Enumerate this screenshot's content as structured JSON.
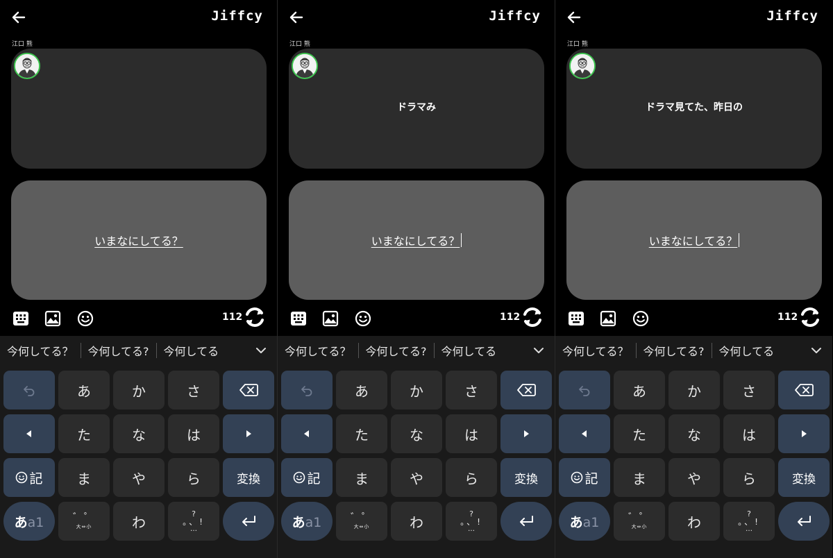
{
  "app": {
    "title": "Jiffcy"
  },
  "author": {
    "name": "江口 熊"
  },
  "input": {
    "placeholder": "いまなにしてる？"
  },
  "char_count": "112",
  "suggestions": [
    "今何してる？",
    "今何してる?",
    "今何してる"
  ],
  "keys": {
    "a": "あ",
    "ka": "か",
    "sa": "さ",
    "ta": "た",
    "na": "な",
    "ha": "は",
    "ma": "ま",
    "ya": "や",
    "ra": "ら",
    "wa": "わ",
    "kigou": "記",
    "henkan": "変換",
    "mode_kana": "あ",
    "mode_alnum": "a1",
    "dakuten_top": "゛゜",
    "dakuten_bottom": "大⇔小",
    "punct_top": "?",
    "punct_mid": "。、!",
    "punct_bottom": "…"
  },
  "panels": [
    {
      "post_text": "",
      "show_caret": false
    },
    {
      "post_text": "ドラマみ",
      "show_caret": true
    },
    {
      "post_text": "ドラマ見てた、昨日の",
      "show_caret": true
    }
  ],
  "icons": [
    "back-arrow-icon",
    "keyboard-grid-icon",
    "image-icon",
    "emoji-icon",
    "refresh-icon",
    "undo-icon",
    "backspace-icon",
    "arrow-left-icon",
    "arrow-right-icon",
    "enter-icon",
    "chevron-down-icon"
  ],
  "colors": {
    "background": "#000000",
    "card": "#2c2c2c",
    "input_card": "#5d5d5d",
    "keyboard_bg": "#1a1a1a",
    "key": "#2c2c2c",
    "function_key": "#334155",
    "avatar_ring": "#3ec64f"
  }
}
